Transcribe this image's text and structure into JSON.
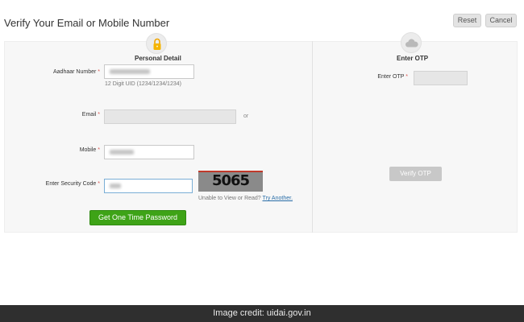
{
  "header": {
    "title": "Verify Your Email or Mobile Number",
    "reset_label": "Reset",
    "cancel_label": "Cancel"
  },
  "personal_detail": {
    "heading": "Personal Detail",
    "icon": "lock-icon",
    "aadhaar_label": "Aadhaar Number",
    "aadhaar_hint": "12 Digit UID (1234/1234/1234)",
    "email_label": "Email",
    "or_text": "or",
    "mobile_label": "Mobile",
    "security_code_label": "Enter Security Code",
    "captcha_text": "5065",
    "captcha_note": "Unable to View or Read?",
    "try_another": "Try Another.",
    "submit_label": "Get One Time Password",
    "required_mark": "*"
  },
  "otp": {
    "heading": "Enter OTP",
    "icon": "cloud-icon",
    "otp_label": "Enter OTP",
    "verify_label": "Verify OTP"
  },
  "footer": {
    "credit": "Image credit: uidai.gov.in"
  },
  "colors": {
    "primary_button": "#3ea317",
    "required": "#d9534f",
    "link": "#2a6ea8",
    "disabled_button": "#c8c8c8"
  }
}
